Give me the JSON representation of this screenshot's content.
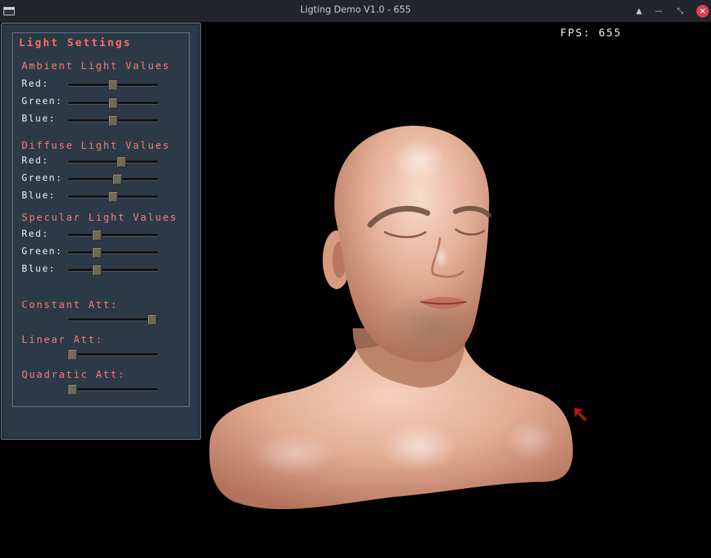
{
  "window": {
    "title": "Ligting Demo V1.0 - 655",
    "buttons": {
      "keep_above": "▲",
      "minimize": "—",
      "restore": "⤡",
      "close": "✕"
    }
  },
  "hud": {
    "fps": "FPS: 655"
  },
  "panel": {
    "title": "Light Settings",
    "ambient": {
      "title": "Ambient Light Values",
      "red": {
        "label": "Red:",
        "value": 0.5
      },
      "green": {
        "label": "Green:",
        "value": 0.5
      },
      "blue": {
        "label": "Blue:",
        "value": 0.5
      }
    },
    "diffuse": {
      "title": "Diffuse Light Values",
      "red": {
        "label": "Red:",
        "value": 0.59
      },
      "green": {
        "label": "Green:",
        "value": 0.55
      },
      "blue": {
        "label": "Blue:",
        "value": 0.5
      }
    },
    "specular": {
      "title": "Specular Light Values",
      "red": {
        "label": "Red:",
        "value": 0.32
      },
      "green": {
        "label": "Green:",
        "value": 0.32
      },
      "blue": {
        "label": "Blue:",
        "value": 0.32
      }
    },
    "constant_att": {
      "label": "Constant Att:",
      "value": 0.94
    },
    "linear_att": {
      "label": "Linear Att:",
      "value": 0.05
    },
    "quadratic_att": {
      "label": "Quadratic Att:",
      "value": 0.05
    }
  },
  "colors": {
    "accent_text": "#ff6a6a",
    "panel_bg": "#2c3a47",
    "close_button": "#e04050",
    "skin": "#e6b098"
  }
}
